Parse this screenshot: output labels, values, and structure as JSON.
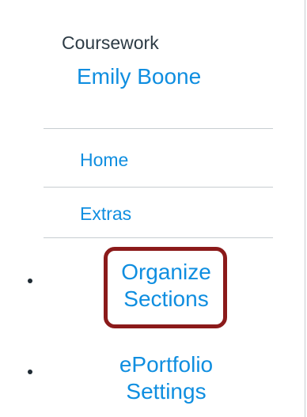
{
  "header": {
    "context_label": "Coursework",
    "owner_name": "Emily Boone"
  },
  "nav": {
    "items": [
      {
        "label": "Home"
      },
      {
        "label": "Extras"
      }
    ]
  },
  "menu": {
    "items": [
      {
        "line1": "Organize",
        "line2": "Sections",
        "highlighted": true
      },
      {
        "line1": "ePortfolio",
        "line2": "Settings",
        "highlighted": false
      }
    ]
  },
  "colors": {
    "link": "#0f8ee0",
    "text": "#2d3b45",
    "highlight_border": "#8b1a1a",
    "divider": "#c7cdd1"
  }
}
